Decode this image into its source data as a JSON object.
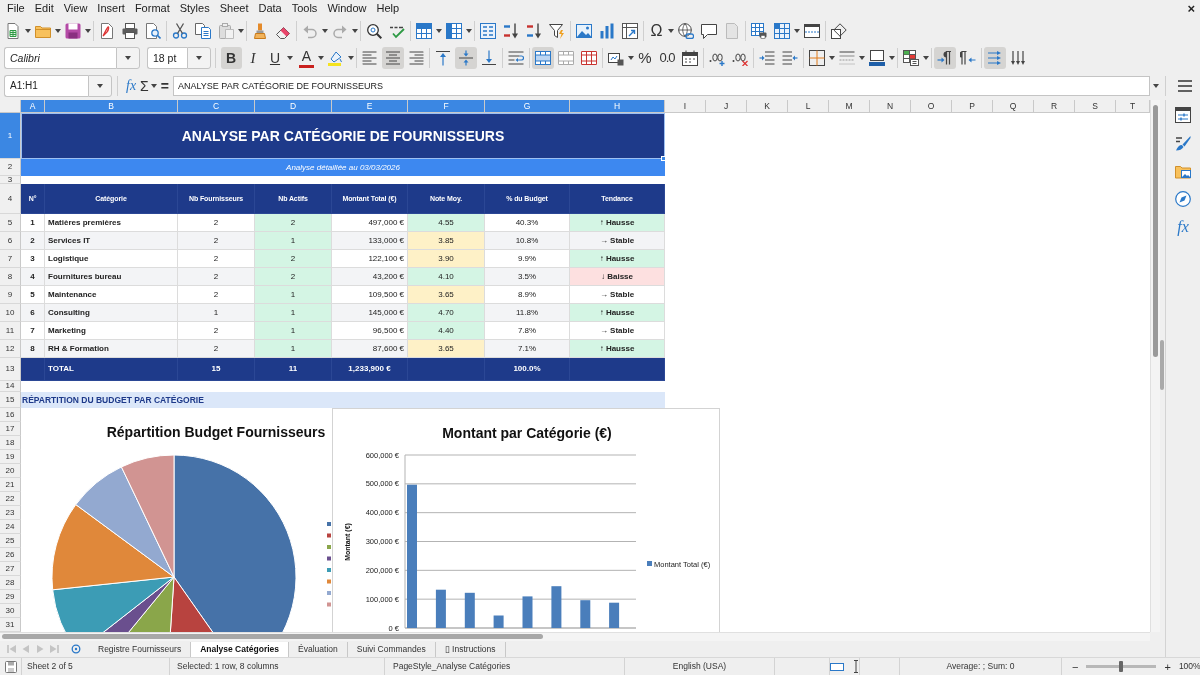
{
  "menu_bar": {
    "items": [
      "File",
      "Edit",
      "View",
      "Insert",
      "Format",
      "Styles",
      "Sheet",
      "Data",
      "Tools",
      "Window",
      "Help"
    ],
    "close_label": "×"
  },
  "standard_toolbar": {
    "special_character_label": "Ω"
  },
  "formatting_toolbar": {
    "font_name": "Calibri",
    "font_size": "18 pt",
    "style_buttons": [
      {
        "label": "B",
        "selected": true
      },
      {
        "label": "I",
        "selected": false
      },
      {
        "label": "U",
        "selected": false
      }
    ],
    "font_color_label": "A",
    "horizontal_align": [
      {
        "selected": false
      },
      {
        "selected": true
      },
      {
        "selected": false
      }
    ],
    "vertical_align": [
      {
        "selected": false
      },
      {
        "selected": true
      },
      {
        "selected": false
      }
    ],
    "merge_buttons": [
      {
        "selected": true
      },
      {
        "selected": false
      },
      {
        "selected": false
      }
    ],
    "percent_label": "%",
    "number_label": "0.0",
    "direction_buttons": [
      {
        "selected": true
      },
      {
        "selected": false
      }
    ],
    "text_flow_buttons": [
      {
        "selected": true
      },
      {
        "selected": false
      }
    ]
  },
  "formula_bar": {
    "name_box": "A1:H1",
    "function_wizard_label": "fx",
    "sum_label": "Σ",
    "equals_label": "=",
    "formula": "ANALYSE PAR CATÉGORIE DE FOURNISSEURS"
  },
  "sheet": {
    "columns": [
      {
        "label": "A",
        "selected": true
      },
      {
        "label": "B",
        "selected": true
      },
      {
        "label": "C",
        "selected": true
      },
      {
        "label": "D",
        "selected": true
      },
      {
        "label": "E",
        "selected": true
      },
      {
        "label": "F",
        "selected": true
      },
      {
        "label": "G",
        "selected": true
      },
      {
        "label": "H",
        "selected": true
      },
      {
        "label": "I",
        "selected": false
      },
      {
        "label": "J",
        "selected": false
      },
      {
        "label": "K",
        "selected": false
      },
      {
        "label": "L",
        "selected": false
      },
      {
        "label": "M",
        "selected": false
      },
      {
        "label": "N",
        "selected": false
      },
      {
        "label": "O",
        "selected": false
      },
      {
        "label": "P",
        "selected": false
      },
      {
        "label": "Q",
        "selected": false
      },
      {
        "label": "R",
        "selected": false
      },
      {
        "label": "S",
        "selected": false
      },
      {
        "label": "T",
        "selected": false
      }
    ],
    "rows": [
      {
        "label": "1",
        "selected": true
      },
      {
        "label": "2",
        "selected": false
      },
      {
        "label": "3",
        "selected": false
      },
      {
        "label": "4",
        "selected": false
      },
      {
        "label": "5",
        "selected": false
      },
      {
        "label": "6",
        "selected": false
      },
      {
        "label": "7",
        "selected": false
      },
      {
        "label": "8",
        "selected": false
      },
      {
        "label": "9",
        "selected": false
      },
      {
        "label": "10",
        "selected": false
      },
      {
        "label": "11",
        "selected": false
      },
      {
        "label": "12",
        "selected": false
      },
      {
        "label": "13",
        "selected": false
      },
      {
        "label": "14",
        "selected": false
      },
      {
        "label": "15",
        "selected": false
      },
      {
        "label": "16",
        "selected": false
      },
      {
        "label": "17",
        "selected": false
      },
      {
        "label": "18",
        "selected": false
      },
      {
        "label": "19",
        "selected": false
      },
      {
        "label": "20",
        "selected": false
      },
      {
        "label": "21",
        "selected": false
      },
      {
        "label": "22",
        "selected": false
      },
      {
        "label": "23",
        "selected": false
      },
      {
        "label": "24",
        "selected": false
      },
      {
        "label": "25",
        "selected": false
      },
      {
        "label": "26",
        "selected": false
      },
      {
        "label": "27",
        "selected": false
      },
      {
        "label": "28",
        "selected": false
      },
      {
        "label": "29",
        "selected": false
      },
      {
        "label": "30",
        "selected": false
      },
      {
        "label": "31",
        "selected": false
      }
    ],
    "title": "ANALYSE PAR CATÉGORIE DE FOURNISSEURS",
    "subtitle": "Analyse détaillée au 03/03/2026",
    "table": {
      "columns": [
        "N°",
        "Catégorie",
        "Nb Fournisseurs",
        "Nb Actifs",
        "Montant Total (€)",
        "Note Moy.",
        "% du Budget",
        "Tendance"
      ],
      "rows": [
        {
          "n": "1",
          "category": "Matières premières",
          "suppliers": "2",
          "active": {
            "text": "2",
            "color": "#d4f5e4"
          },
          "amount": "497,000 €",
          "rating": {
            "text": "4.55",
            "color": "#d4f5e4"
          },
          "budget": "40.3%",
          "trend": {
            "text": "↑ Hausse",
            "color": "#d4f5e4"
          }
        },
        {
          "n": "2",
          "category": "Services IT",
          "suppliers": "2",
          "active": {
            "text": "1",
            "color": "#d4f5e4"
          },
          "amount": "133,000 €",
          "rating": {
            "text": "3.85",
            "color": "#fef1c7"
          },
          "budget": "10.8%",
          "trend": {
            "text": "→ Stable"
          }
        },
        {
          "n": "3",
          "category": "Logistique",
          "suppliers": "2",
          "active": {
            "text": "2",
            "color": "#d4f5e4"
          },
          "amount": "122,100 €",
          "rating": {
            "text": "3.90",
            "color": "#fef1c7"
          },
          "budget": "9.9%",
          "trend": {
            "text": "↑ Hausse",
            "color": "#d4f5e4"
          }
        },
        {
          "n": "4",
          "category": "Fournitures bureau",
          "suppliers": "2",
          "active": {
            "text": "2",
            "color": "#d4f5e4"
          },
          "amount": "43,200 €",
          "rating": {
            "text": "4.10",
            "color": "#d4f5e4"
          },
          "budget": "3.5%",
          "trend": {
            "text": "↓ Baisse",
            "color": "#fde0e0"
          }
        },
        {
          "n": "5",
          "category": "Maintenance",
          "suppliers": "2",
          "active": {
            "text": "1",
            "color": "#d4f5e4"
          },
          "amount": "109,500 €",
          "rating": {
            "text": "3.65",
            "color": "#fef1c7"
          },
          "budget": "8.9%",
          "trend": {
            "text": "→ Stable"
          }
        },
        {
          "n": "6",
          "category": "Consulting",
          "suppliers": "1",
          "active": {
            "text": "1",
            "color": "#d4f5e4"
          },
          "amount": "145,000 €",
          "rating": {
            "text": "4.70",
            "color": "#d4f5e4"
          },
          "budget": "11.8%",
          "trend": {
            "text": "↑ Hausse",
            "color": "#d4f5e4"
          }
        },
        {
          "n": "7",
          "category": "Marketing",
          "suppliers": "2",
          "active": {
            "text": "1",
            "color": "#d4f5e4"
          },
          "amount": "96,500 €",
          "rating": {
            "text": "4.40",
            "color": "#d4f5e4"
          },
          "budget": "7.8%",
          "trend": {
            "text": "→ Stable"
          }
        },
        {
          "n": "8",
          "category": "RH & Formation",
          "suppliers": "2",
          "active": {
            "text": "1",
            "color": "#d4f5e4"
          },
          "amount": "87,600 €",
          "rating": {
            "text": "3.65",
            "color": "#fef1c7"
          },
          "budget": "7.1%",
          "trend": {
            "text": "↑ Hausse",
            "color": "#d4f5e4"
          }
        }
      ],
      "total": {
        "label": "TOTAL",
        "suppliers": "15",
        "active": "11",
        "amount": "1,233,900 €",
        "budget": "100.0%"
      }
    },
    "section_heading": "RÉPARTITION DU BUDGET PAR CATÉGORIE",
    "charts": [
      {
        "chart_data": {
          "type": "pie",
          "title": "Répartition Budget Fournisseurs",
          "values": [
            40.3,
            10.8,
            9.9,
            3.5,
            8.9,
            11.8,
            7.8,
            7.1
          ]
        }
      },
      {
        "chart_data": {
          "type": "bar",
          "title": "Montant par Catégorie (€)",
          "ylabel": "Montant (€)",
          "ylim": [
            0,
            600000
          ],
          "grid": true,
          "yticks": [
            {
              "value": 0,
              "label": "0 €"
            },
            {
              "value": 100000,
              "label": "100,000 €"
            },
            {
              "value": 200000,
              "label": "200,000 €"
            },
            {
              "value": 300000,
              "label": "300,000 €"
            },
            {
              "value": 400000,
              "label": "400,000 €"
            },
            {
              "value": 500000,
              "label": "500,000 €"
            },
            {
              "value": 600000,
              "label": "600,000 €"
            }
          ],
          "series": [
            {
              "name": "Montant Total (€)",
              "color": "#4a7ebb",
              "values": [
                497000,
                133000,
                122100,
                43200,
                109500,
                145000,
                96500,
                87600
              ]
            }
          ]
        }
      }
    ]
  },
  "sidebar": {
    "functions_label": "fx"
  },
  "sheet_tabs": [
    {
      "label": "Registre Fournisseurs",
      "selected": false
    },
    {
      "label": "Analyse Catégories",
      "selected": true
    },
    {
      "label": "Évaluation",
      "selected": false
    },
    {
      "label": "Suivi Commandes",
      "selected": false
    },
    {
      "label": "▯ Instructions",
      "selected": false
    }
  ],
  "status_bar": {
    "sheet_position": "Sheet 2 of 5",
    "selection": "Selected: 1 row, 8 columns",
    "page_style": "PageStyle_Analyse Catégories",
    "language": "English (USA)",
    "summary": "Average: ; Sum: 0",
    "zoom_out_label": "−",
    "zoom_in_label": "+",
    "zoom_slider": {
      "level": 0.5
    },
    "zoom": "100%"
  }
}
